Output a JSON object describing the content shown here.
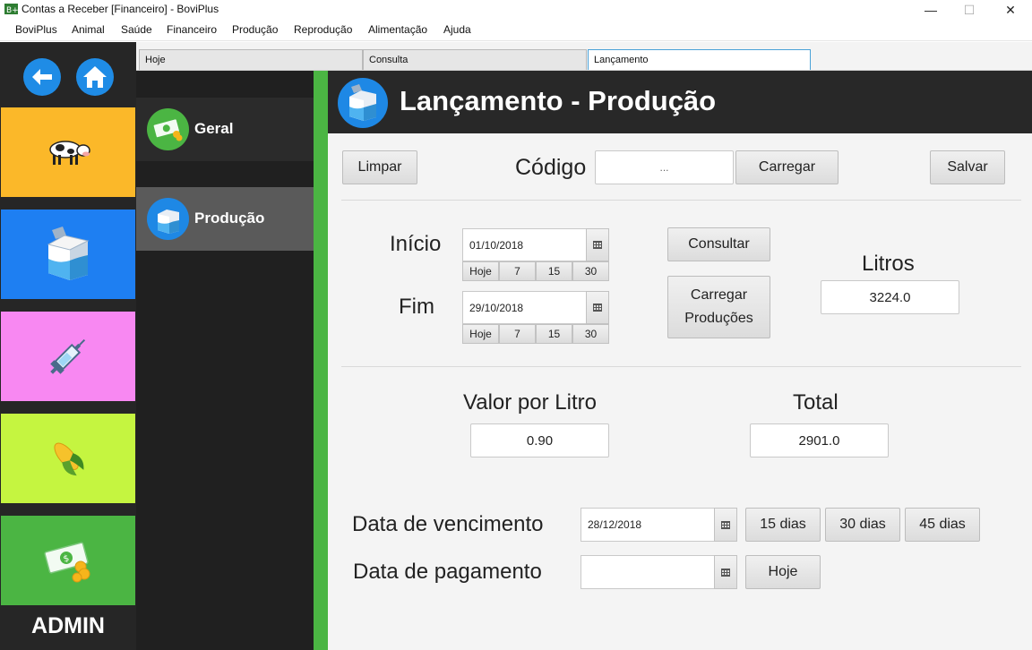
{
  "window": {
    "title": "Contas a Receber [Financeiro] - BoviPlus",
    "minimize": "—",
    "maximize": "☐",
    "close": "✕"
  },
  "menu": [
    "BoviPlus",
    "Animal",
    "Saúde",
    "Financeiro",
    "Produção",
    "Reprodução",
    "Alimentação",
    "Ajuda"
  ],
  "tabs": [
    "Hoje",
    "Consulta",
    "Lançamento"
  ],
  "sidebar": {
    "admin_label": "ADMIN",
    "tile_colors": [
      "#fbb829",
      "#1e7ff2",
      "#f888f2",
      "#c5f540",
      "#4bb543"
    ]
  },
  "nav": {
    "items": [
      {
        "label": "Geral"
      },
      {
        "label": "Produção"
      }
    ]
  },
  "header": {
    "title": "Lançamento - Produção"
  },
  "form": {
    "limpar": "Limpar",
    "codigo_label": "Código",
    "codigo_value": "...",
    "carregar": "Carregar",
    "salvar": "Salvar",
    "inicio_label": "Início",
    "inicio_value": "01/10/2018",
    "fim_label": "Fim",
    "fim_value": "29/10/2018",
    "quick": [
      "Hoje",
      "7",
      "15",
      "30"
    ],
    "consultar": "Consultar",
    "carregar_producoes_1": "Carregar",
    "carregar_producoes_2": "Produções",
    "litros_label": "Litros",
    "litros_value": "3224.0",
    "valor_litro_label": "Valor por Litro",
    "valor_litro_value": "0.90",
    "total_label": "Total",
    "total_value": "2901.0",
    "vencimento_label": "Data de vencimento",
    "vencimento_value": "28/12/2018",
    "dias": [
      "15 dias",
      "30 dias",
      "45 dias"
    ],
    "pagamento_label": "Data de pagamento",
    "pagamento_value": "",
    "hoje": "Hoje"
  }
}
